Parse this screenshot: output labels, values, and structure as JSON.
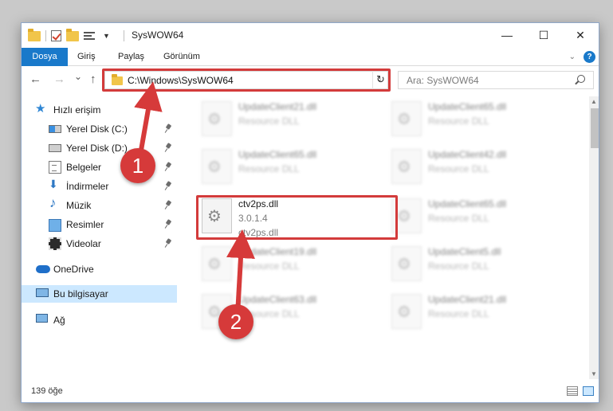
{
  "window": {
    "title": "SysWOW64",
    "controls": {
      "minimize": "—",
      "maximize": "☐",
      "close": "✕"
    }
  },
  "ribbon": {
    "tabs": [
      "Dosya",
      "Giriş",
      "Paylaş",
      "Görünüm"
    ],
    "active_tab": "Dosya",
    "help_label": "?"
  },
  "navigation": {
    "back": "←",
    "forward": "→",
    "recent": "⌄",
    "up": "↑",
    "address": "C:\\Windows\\SysWOW64",
    "refresh": "↻",
    "search_placeholder": "Ara: SysWOW64"
  },
  "sidebar": {
    "items": [
      {
        "label": "Hızlı erişim",
        "icon": "star-icon"
      },
      {
        "label": "Yerel Disk (C:)",
        "icon": "drive-icon",
        "pinned": true
      },
      {
        "label": "Yerel Disk (D:)",
        "icon": "drive-icon",
        "pinned": true
      },
      {
        "label": "Belgeler",
        "icon": "documents-icon",
        "pinned": true
      },
      {
        "label": "İndirmeler",
        "icon": "downloads-icon",
        "pinned": true
      },
      {
        "label": "Müzik",
        "icon": "music-icon",
        "pinned": true
      },
      {
        "label": "Resimler",
        "icon": "pictures-icon",
        "pinned": true
      },
      {
        "label": "Videolar",
        "icon": "videos-icon",
        "pinned": true
      },
      {
        "label": "OneDrive",
        "icon": "onedrive-icon"
      },
      {
        "label": "Bu bilgisayar",
        "icon": "this-pc-icon",
        "selected": true
      },
      {
        "label": "Ağ",
        "icon": "network-icon"
      }
    ]
  },
  "files": [
    {
      "name": "UpdateClient21.dll",
      "line2": "Resource DLL",
      "line3": ""
    },
    {
      "name": "UpdateClient65.dll",
      "line2": "Resource DLL",
      "line3": ""
    },
    {
      "name": "UpdateClient65.dll",
      "line2": "Resource DLL",
      "line3": ""
    },
    {
      "name": "UpdateClient42.dll",
      "line2": "Resource DLL",
      "line3": ""
    },
    {
      "name": "ctv2ps.dll",
      "line2": "3.0.1.4",
      "line3": "ctv2ps.dll",
      "highlighted": true
    },
    {
      "name": "UpdateClient65.dll",
      "line2": "Resource DLL",
      "line3": ""
    },
    {
      "name": "UpdateClient19.dll",
      "line2": "Resource DLL",
      "line3": ""
    },
    {
      "name": "UpdateClient5.dll",
      "line2": "Resource DLL",
      "line3": ""
    },
    {
      "name": "UpdateClient63.dll",
      "line2": "Resource DLL",
      "line3": ""
    },
    {
      "name": "UpdateClient21.dll",
      "line2": "Resource DLL",
      "line3": ""
    }
  ],
  "status": {
    "item_count": "139 öğe"
  },
  "callouts": [
    "1",
    "2"
  ],
  "colors": {
    "accent": "#1979ca",
    "highlight": "#d33b3b",
    "selection": "#cce8ff"
  }
}
